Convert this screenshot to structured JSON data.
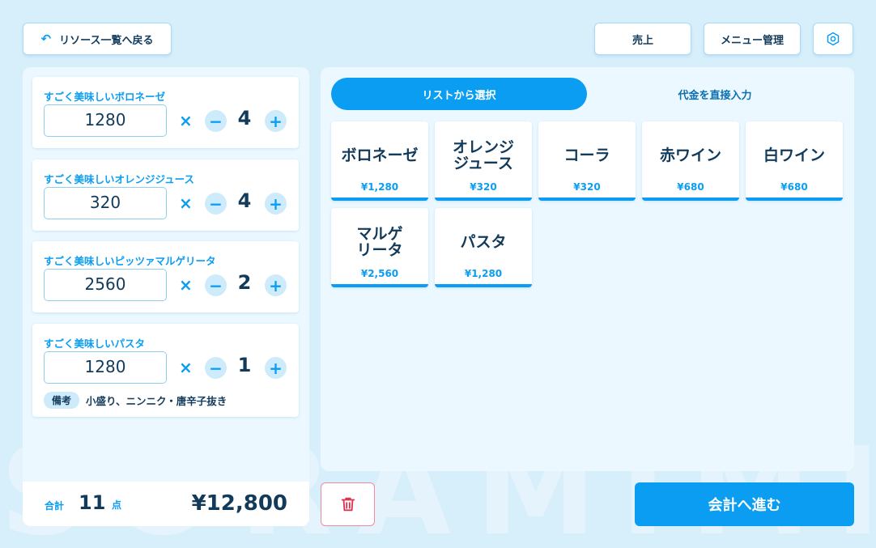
{
  "header": {
    "back_label": "リソース一覧へ戻る",
    "sales_label": "売上",
    "menu_label": "メニュー管理"
  },
  "background_text": "SORAMIMI",
  "order_items": [
    {
      "name": "すごく美味しいボロネーゼ",
      "price": "1280",
      "times": "×",
      "qty": "4",
      "note": null
    },
    {
      "name": "すごく美味しいオレンジジュース",
      "price": "320",
      "times": "×",
      "qty": "4",
      "note": null
    },
    {
      "name": "すごく美味しいピッツァマルゲリータ",
      "price": "2560",
      "times": "×",
      "qty": "2",
      "note": null
    },
    {
      "name": "すごく美味しいパスタ",
      "price": "1280",
      "times": "×",
      "qty": "1",
      "note": {
        "label": "備考",
        "text": "小盛り、ニンニク・唐辛子抜き"
      }
    }
  ],
  "total": {
    "label": "合計",
    "count": "11",
    "unit": "点",
    "amount": "¥12,800"
  },
  "tabs": {
    "list": "リストから選択",
    "direct": "代金を直接入力"
  },
  "products": [
    {
      "name": "ボロネーゼ",
      "price": "¥1,280"
    },
    {
      "name": "オレンジ\nジュース",
      "price": "¥320"
    },
    {
      "name": "コーラ",
      "price": "¥320"
    },
    {
      "name": "赤ワイン",
      "price": "¥680"
    },
    {
      "name": "白ワイン",
      "price": "¥680"
    },
    {
      "name": "マルゲ\nリータ",
      "price": "¥2,560"
    },
    {
      "name": "パスタ",
      "price": "¥1,280"
    }
  ],
  "checkout_label": "会計へ進む",
  "colors": {
    "accent": "#0a9df2",
    "background": "#d7eefb",
    "text": "#123a5a",
    "danger": "#e0334f"
  },
  "icons": {
    "back": "undo-arrow-icon",
    "settings": "gear-icon",
    "delete": "trash-icon"
  }
}
